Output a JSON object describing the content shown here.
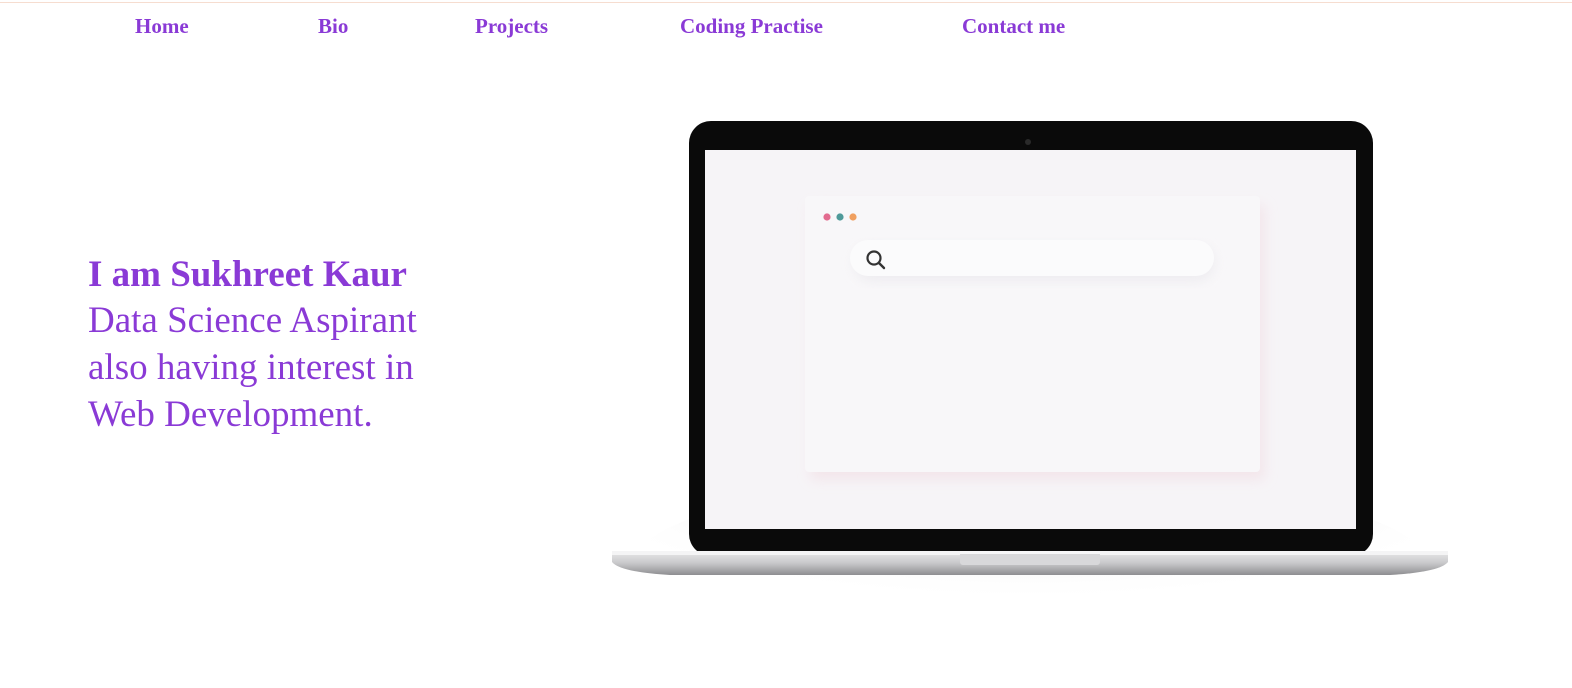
{
  "nav": {
    "items": [
      {
        "label": "Home"
      },
      {
        "label": "Bio"
      },
      {
        "label": "Projects"
      },
      {
        "label": "Coding Practise"
      },
      {
        "label": "Contact me"
      }
    ]
  },
  "hero": {
    "title": "I am Sukhreet Kaur",
    "subtitle_lines": [
      "Data Science Aspirant",
      "also having interest in",
      "Web Development."
    ]
  },
  "colors": {
    "accent": "#8a3ad6",
    "window_dot_1": "#e26b8f",
    "window_dot_2": "#4f9a9a",
    "window_dot_3": "#f0a060"
  },
  "illustration": {
    "laptop_search_icon": "search-icon"
  }
}
